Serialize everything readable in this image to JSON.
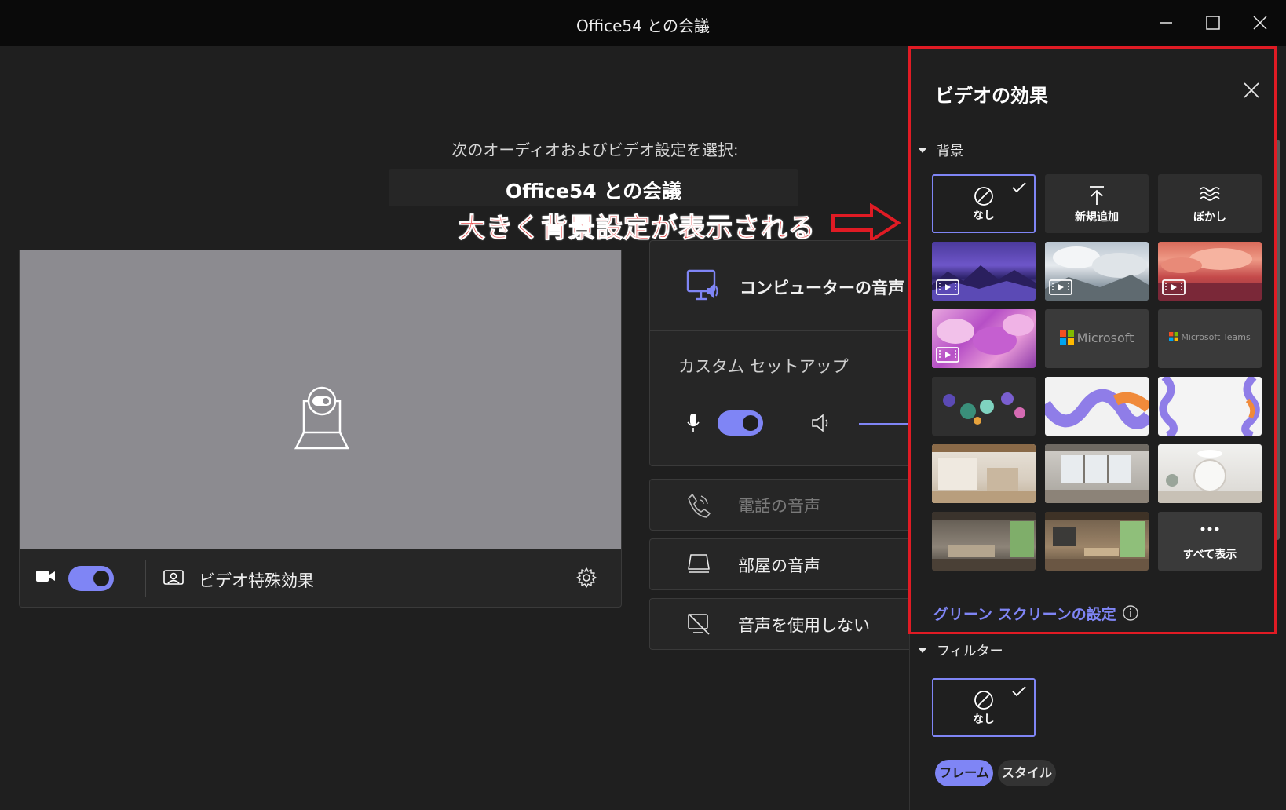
{
  "window": {
    "title": "Office54 との会議"
  },
  "prejoin": {
    "subtitle": "次のオーディオおよびビデオ設定を選択:",
    "meeting_title": "Office54 との会議",
    "annotation": "大きく背景設定が表示される"
  },
  "video_bar": {
    "camera_on": true,
    "effects_label": "ビデオ特殊効果"
  },
  "audio": {
    "computer_audio": "コンピューターの音声",
    "custom_setup": "カスタム セットアップ",
    "mic_on": true,
    "phone_audio": "電話の音声",
    "room_audio": "部屋の音声",
    "no_audio": "音声を使用しない"
  },
  "effects_panel": {
    "title": "ビデオの効果",
    "background_section": "背景",
    "tiles": {
      "none": "なし",
      "add_new": "新規追加",
      "blur": "ぼかし",
      "microsoft": "Microsoft",
      "microsoft_teams": "Microsoft Teams",
      "show_all": "すべて表示"
    },
    "green_screen": "グリーン スクリーンの設定",
    "filter_section": "フィルター",
    "filter_none": "なし",
    "pills": {
      "frame": "フレーム",
      "style": "スタイル"
    }
  },
  "colors": {
    "accent": "#7f85f5",
    "annotation_red": "#e01b24"
  }
}
